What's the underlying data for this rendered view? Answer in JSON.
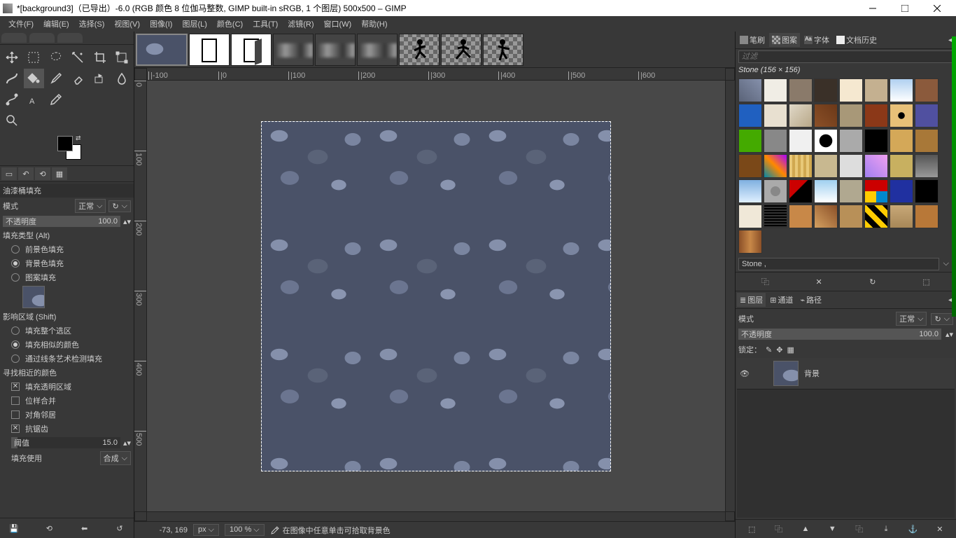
{
  "window": {
    "title": "*[background3]（已导出）-6.0 (RGB 颜色 8 位伽马整数, GIMP built-in sRGB, 1 个图层) 500x500 – GIMP"
  },
  "menu": {
    "file": "文件(F)",
    "edit": "编辑(E)",
    "select": "选择(S)",
    "view": "视图(V)",
    "image": "图像(I)",
    "layer": "图层(L)",
    "color": "颜色(C)",
    "tools": "工具(T)",
    "filters": "滤镜(R)",
    "window": "窗口(W)",
    "help": "帮助(H)"
  },
  "toolopts": {
    "title": "油漆桶填充",
    "modeLabel": "模式",
    "modeValue": "正常",
    "opacityLabel": "不透明度",
    "opacityValue": "100.0",
    "fillTypeHeader": "填充类型 (Alt)",
    "fillFg": "前景色填充",
    "fillBg": "背景色填充",
    "fillPattern": "图案填充",
    "patternName": "Stone",
    "affectHeader": "影响区域 (Shift)",
    "affectSelection": "填充整个选区",
    "affectSimilar": "填充相似的颜色",
    "affectLine": "通过线条艺术检测填充",
    "findHeader": "寻找相近的颜色",
    "fillTransparent": "填充透明区域",
    "sampleMerged": "位样合并",
    "diagonal": "对角邻居",
    "antialias": "抗锯齿",
    "thresholdLabel": "阈值",
    "thresholdValue": "15.0",
    "fillUseLabel": "填充使用",
    "fillUseValue": "合成"
  },
  "status": {
    "coord": "-73, 169",
    "unit": "px",
    "zoom": "100 %",
    "hint": "在图像中任意单击可拾取背景色"
  },
  "rightTabs": {
    "brush": "笔刷",
    "pattern": "图案",
    "font": "字体",
    "history": "文档历史"
  },
  "patterns": {
    "filterPlaceholder": "过滤",
    "selectedInfo": "Stone (156 × 156)",
    "selectedName": "Stone ,"
  },
  "layers": {
    "tabLayer": "图层",
    "tabChannel": "通道",
    "tabPath": "路径",
    "modeLabel": "模式",
    "modeValue": "正常",
    "opacityLabel": "不透明度",
    "opacityValue": "100.0",
    "lockLabel": "锁定：",
    "layerName": "背景"
  },
  "ruler": {
    "hMarks": [
      "-100",
      "0",
      "100",
      "200",
      "300",
      "400",
      "500",
      "600"
    ],
    "vMarks": [
      "0",
      "100",
      "200",
      "300",
      "400",
      "500"
    ]
  }
}
